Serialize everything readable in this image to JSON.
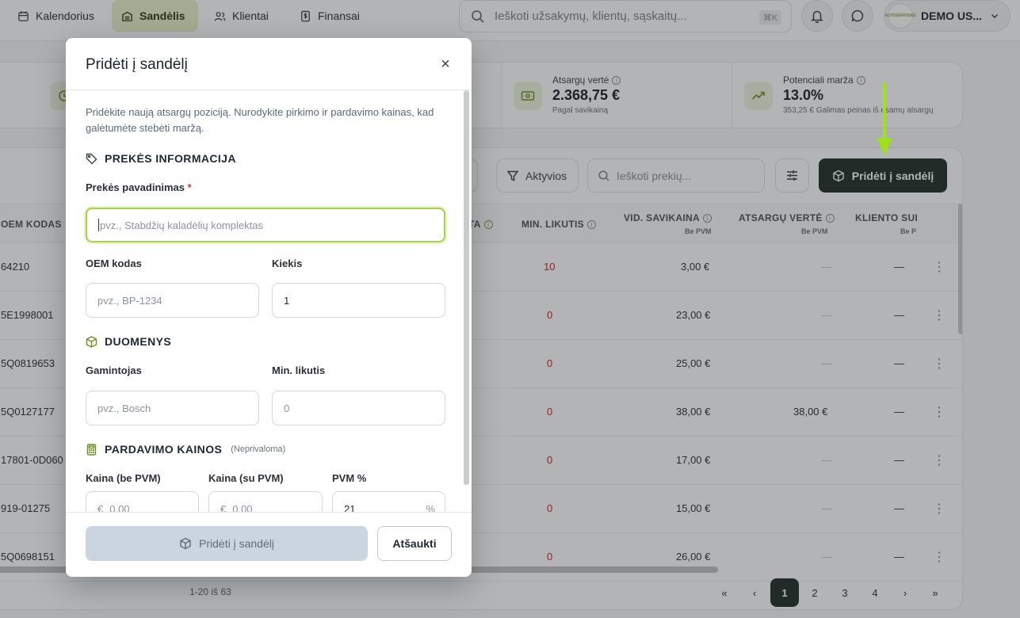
{
  "nav": {
    "tabs": [
      {
        "label": "Kalendorius",
        "icon": "calendar-icon"
      },
      {
        "label": "Sandėlis",
        "icon": "warehouse-icon",
        "active": true
      },
      {
        "label": "Klientai",
        "icon": "users-icon"
      },
      {
        "label": "Finansai",
        "icon": "finance-icon"
      }
    ],
    "search_placeholder": "Ieškoti užsakymų, klientų, sąskaitų...",
    "search_shortcut": "⌘K",
    "user_name": "DEMO US...",
    "logo_text": "AUTOSERVISAS"
  },
  "stats": {
    "stock_value": {
      "label": "Atsargų vertė",
      "value": "2.368,75 €",
      "sub": "Pagal savikainą"
    },
    "potential_margin": {
      "label": "Potenciali marža",
      "value": "13.0%",
      "sub": "353,25 € Galimas peinas iš esamų atsargų"
    }
  },
  "toolbar": {
    "partial_button": "s",
    "filter_label": "Aktyvios",
    "search_placeholder": "Ieškoti prekių...",
    "add_label": "Pridėti į sandėlį"
  },
  "table": {
    "headers": {
      "oem": "OEM KODAS",
      "qty_partial": "TA",
      "min": "MIN. LIKUTIS",
      "cost": "VID. SAVIKAINA",
      "cost_sub": "Be PVM",
      "value": "ATSARGŲ VERTĖ",
      "value_sub": "Be PVM",
      "client": "KLIENTO SUI",
      "client_sub": "Be P"
    },
    "rows": [
      {
        "oem": "64210",
        "min": "10",
        "cost": "3,00 €",
        "value": "—",
        "client": "—"
      },
      {
        "oem": "5E1998001",
        "min": "0",
        "cost": "23,00 €",
        "value": "—",
        "client": "—"
      },
      {
        "oem": "5Q0819653",
        "min": "0",
        "cost": "25,00 €",
        "value": "—",
        "client": "—"
      },
      {
        "oem": "5Q0127177",
        "min": "0",
        "cost": "38,00 €",
        "value": "38,00 €",
        "client": "—"
      },
      {
        "oem": "17801-0D060",
        "min": "0",
        "cost": "17,00 €",
        "value": "—",
        "client": "—"
      },
      {
        "oem": "919-01275",
        "min": "0",
        "cost": "15,00 €",
        "value": "—",
        "client": "—"
      },
      {
        "oem": "5Q0698151",
        "min": "0",
        "cost": "26,00 €",
        "value": "—",
        "client": "—"
      }
    ],
    "count_label": "1-20 iš 63",
    "pages": [
      "1",
      "2",
      "3",
      "4"
    ],
    "current_page": "1",
    "first_label": "«",
    "prev_label": "‹",
    "next_label": "›",
    "last_label": "»"
  },
  "modal": {
    "title": "Pridėti į sandėlį",
    "close_label": "×",
    "description": "Pridėkite naują atsargų poziciją. Nurodykite pirkimo ir pardavimo kainas, kad galėtumėte stebėti maržą.",
    "sections": {
      "product_info": "PREKĖS INFORMACIJA",
      "data": "DUOMENYS",
      "prices": "PARDAVIMO KAINOS",
      "prices_optional": "(Neprivaloma)"
    },
    "fields": {
      "name_label": "Prekės pavadinimas",
      "name_required": "*",
      "name_placeholder": "pvz., Stabdžių kaladėlių komplektas",
      "oem_label": "OEM kodas",
      "oem_placeholder": "pvz., BP-1234",
      "qty_label": "Kiekis",
      "qty_value": "1",
      "maker_label": "Gamintojas",
      "maker_placeholder": "pvz., Bosch",
      "min_label": "Min. likutis",
      "min_placeholder": "0",
      "price_net_label": "Kaina (be PVM)",
      "price_net_prefix": "€",
      "price_net_placeholder": "0,00",
      "price_gross_label": "Kaina (su PVM)",
      "price_gross_prefix": "€",
      "price_gross_placeholder": "0,00",
      "vat_label": "PVM %",
      "vat_value": "21",
      "vat_suffix": "%"
    },
    "submit_label": "Pridėti į sandėlį",
    "cancel_label": "Atšaukti"
  },
  "colors": {
    "accent": "#a8d149",
    "dark_button": "#233028",
    "danger": "#d41f1f",
    "arrow": "#9ee01a"
  }
}
